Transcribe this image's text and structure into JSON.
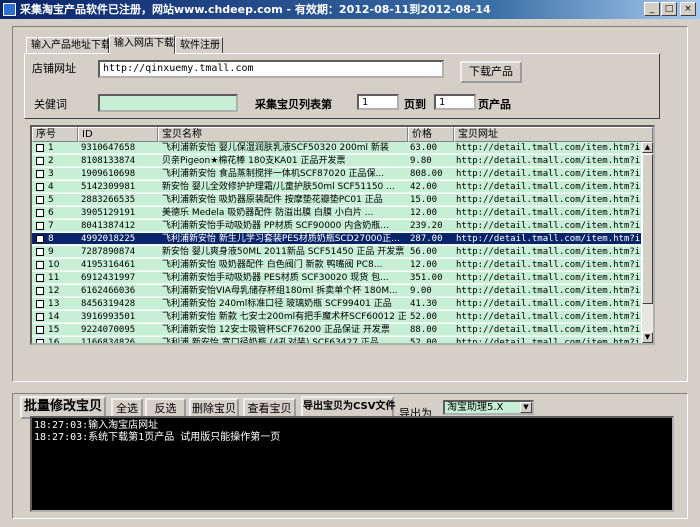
{
  "window": {
    "title": "采集淘宝产品软件已注册，网站www.chdeep.com - 有效期：2012-08-11到2012-08-14",
    "minimize": "_",
    "maximize": "□",
    "close": "×"
  },
  "tabs": [
    "输入产品地址下载",
    "输入网店下载",
    "软件注册"
  ],
  "form": {
    "shop_url_label": "店铺网址",
    "shop_url_value": "http://qinxuemy.tmall.com",
    "download_button": "下载产品",
    "keyword_label": "关健词",
    "keyword_value": "",
    "page_list_label": "采集宝贝列表第",
    "page_from": "1",
    "page_to_label": "页到",
    "page_to": "1",
    "page_unit": "页产品"
  },
  "table": {
    "columns": [
      "序号",
      "ID",
      "宝贝名称",
      "价格",
      "宝贝网址"
    ],
    "selected_index": 7,
    "rows": [
      [
        "1",
        "9310647658",
        "飞利浦新安怡 婴儿保湿润肤乳液SCF50320 200ml 新装",
        "63.00",
        "http://detail.tmall.com/item.htm?i..."
      ],
      [
        "2",
        "8108133874",
        "贝亲Pigeon★棉花棒 180支KA01 正品开发票",
        "9.80",
        "http://detail.tmall.com/item.htm?i..."
      ],
      [
        "3",
        "1909610698",
        "飞利浦新安怡 食品蒸制搅拌一体机SCF87020 正品保...",
        "808.00",
        "http://detail.tmall.com/item.htm?i..."
      ],
      [
        "4",
        "5142309981",
        "新安怡 婴儿全效修护护理霜/儿童护肤50ml SCF51150 ...",
        "42.00",
        "http://detail.tmall.com/item.htm?i..."
      ],
      [
        "5",
        "2883266535",
        "飞利浦新安怡 吸奶器原装配件 按摩垫花瓣垫PC01 正品",
        "15.00",
        "http://detail.tmall.com/item.htm?i..."
      ],
      [
        "6",
        "3905129191",
        "美德乐 Medela 吸奶器配件 防溢出膜 白膜 小白片 ...",
        "12.00",
        "http://detail.tmall.com/item.htm?i..."
      ],
      [
        "7",
        "8041387412",
        "飞利浦新安怡手动吸奶器 PP材质 SCF90000 内含奶瓶...",
        "239.20",
        "http://detail.tmall.com/item.htm?i..."
      ],
      [
        "8",
        "4992018225",
        "飞利浦新安怡 新生儿学习套装PES材质奶瓶SCD27000正...",
        "287.00",
        "http://detail.tmall.com/item.htm?i..."
      ],
      [
        "9",
        "7287890874",
        "新安怡 婴儿爽身液50ML 2011新品 SCF51450 正品 开发票",
        "56.00",
        "http://detail.tmall.com/item.htm?i..."
      ],
      [
        "10",
        "4195316461",
        "飞利浦新安怡 吸奶器配件 白色阀门 新款 鸭嘴阀 PC8...",
        "12.00",
        "http://detail.tmall.com/item.htm?i..."
      ],
      [
        "11",
        "6912431997",
        "飞利浦新安怡手动吸奶器 PES材质 SCF30020 现货 包...",
        "351.00",
        "http://detail.tmall.com/item.htm?i..."
      ],
      [
        "12",
        "6162466036",
        "飞利浦新安怡VIA母乳储存杯组180ml 拆卖单个杯 180M...",
        "9.00",
        "http://detail.tmall.com/item.htm?i..."
      ],
      [
        "13",
        "8456319428",
        "飞利浦新安怡 240ml标准口径 玻璃奶瓶 SCF99401 正品",
        "41.30",
        "http://detail.tmall.com/item.htm?i..."
      ],
      [
        "14",
        "3916993501",
        "飞利浦新安怡 新款 七安士200ml有把手魔术杯SCF60012 正品",
        "52.00",
        "http://detail.tmall.com/item.htm?i..."
      ],
      [
        "15",
        "9224070095",
        "飞利浦新安怡 12安士吸管杯SCF76200 正品保证 开发票",
        "88.00",
        "http://detail.tmall.com/item.htm?i..."
      ],
      [
        "16",
        "1166834826",
        "飞利浦 新安怡 宽口径奶瓶 (4孔对装) SCF63427 正品...",
        "52.00",
        "http://detail.tmall.com/item.htm?i..."
      ]
    ]
  },
  "bottom": {
    "batch_edit": "批量修改宝贝",
    "select_all": "全选",
    "invert": "反选",
    "delete": "删除宝贝",
    "view": "查看宝贝",
    "export_csv": "导出宝贝为CSV文件",
    "export_as_label": "导出为",
    "export_format": "淘宝助理5.X"
  },
  "log": [
    "18:27:03:输入淘宝店网址",
    "18:27:03:系统下载第1页产品 试用版只能操作第一页"
  ]
}
